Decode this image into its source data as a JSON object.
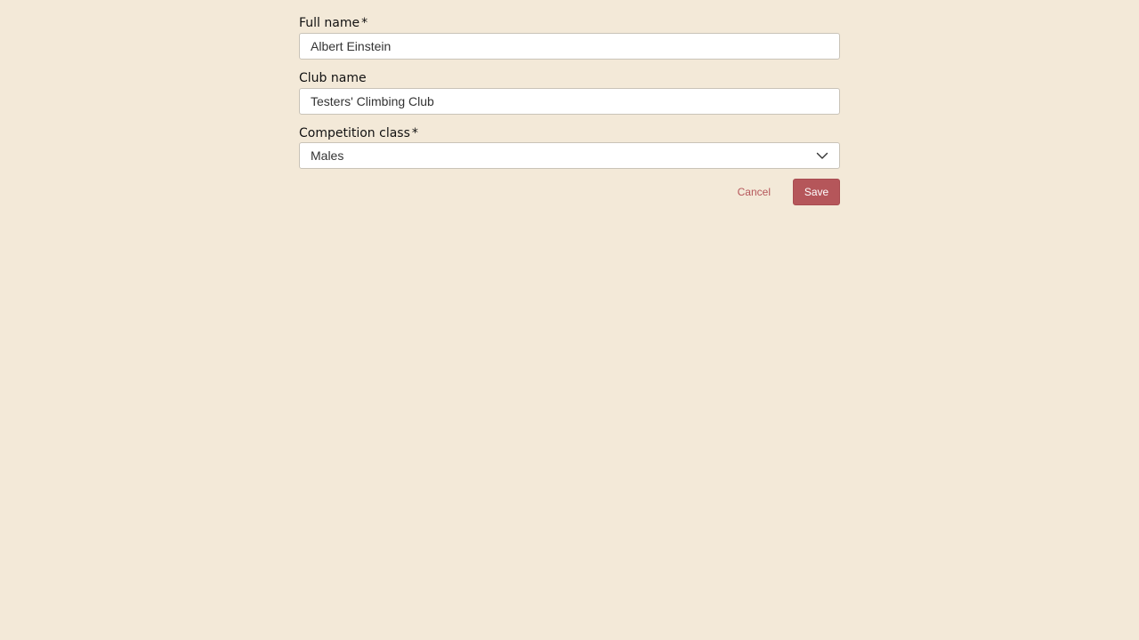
{
  "form": {
    "full_name": {
      "label": "Full name",
      "required_mark": "*",
      "value": "Albert Einstein"
    },
    "club_name": {
      "label": "Club name",
      "value": "Testers' Climbing Club"
    },
    "competition_class": {
      "label": "Competition class",
      "required_mark": "*",
      "selected": "Males",
      "icon": "chevron-down-icon"
    },
    "actions": {
      "cancel_label": "Cancel",
      "save_label": "Save"
    }
  },
  "colors": {
    "background": "#f3e9d8",
    "accent": "#b5565a",
    "field_background": "#ffffff",
    "field_border": "#c9c3b8"
  }
}
